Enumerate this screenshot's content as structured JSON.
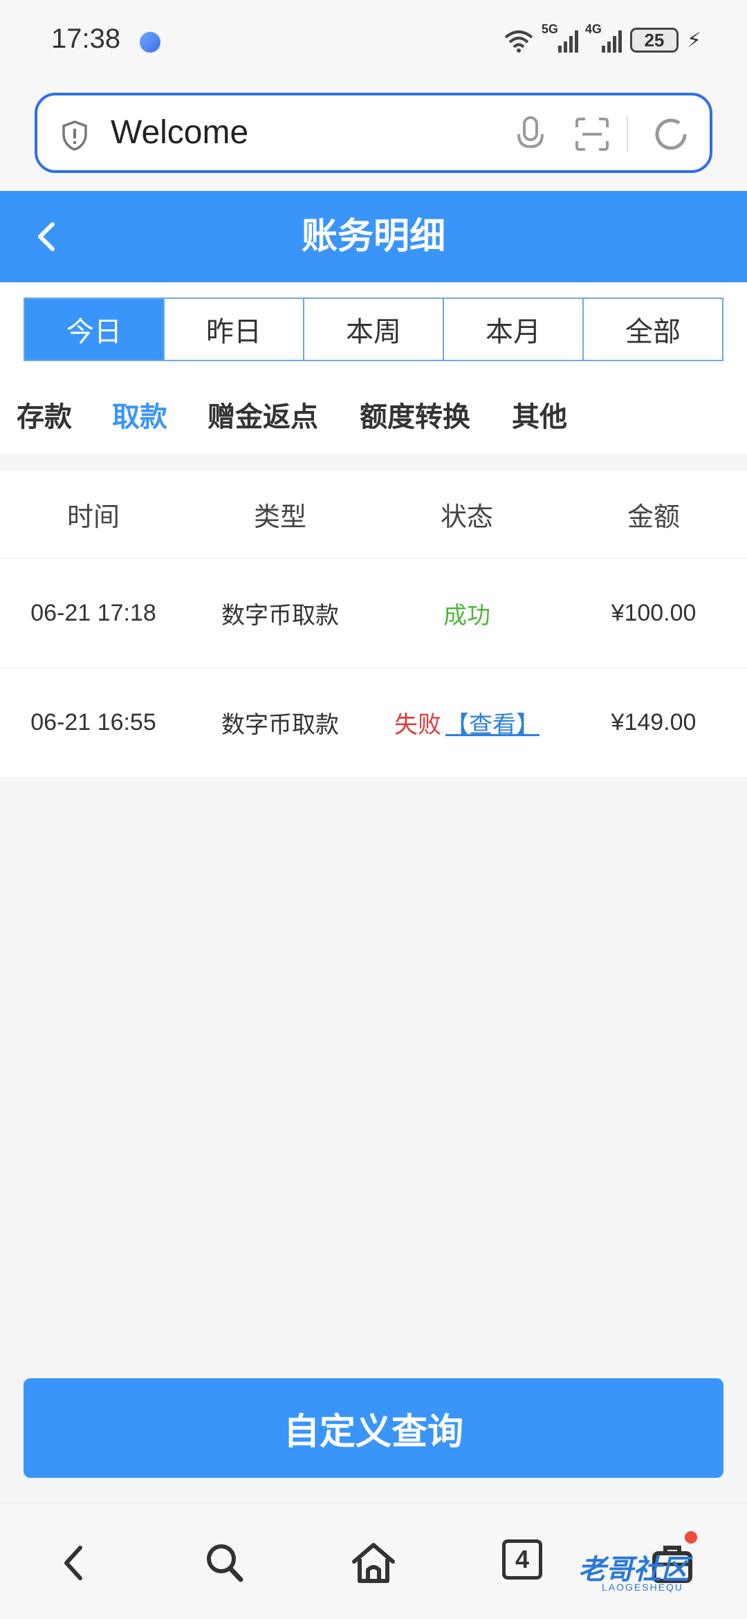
{
  "status_bar": {
    "time": "17:38",
    "network_5g": "5G",
    "network_4g": "4G",
    "battery": "25"
  },
  "browser": {
    "url_text": "Welcome"
  },
  "header": {
    "title": "账务明细"
  },
  "period_tabs": [
    {
      "label": "今日",
      "active": true
    },
    {
      "label": "昨日",
      "active": false
    },
    {
      "label": "本周",
      "active": false
    },
    {
      "label": "本月",
      "active": false
    },
    {
      "label": "全部",
      "active": false
    }
  ],
  "type_tabs": [
    {
      "label": "存款",
      "active": false
    },
    {
      "label": "取款",
      "active": true
    },
    {
      "label": "赠金返点",
      "active": false
    },
    {
      "label": "额度转换",
      "active": false
    },
    {
      "label": "其他",
      "active": false
    }
  ],
  "table": {
    "headers": [
      "时间",
      "类型",
      "状态",
      "金额"
    ],
    "rows": [
      {
        "time": "06-21 17:18",
        "type": "数字币取款",
        "status": "成功",
        "status_kind": "success",
        "view": "",
        "amount": "¥100.00"
      },
      {
        "time": "06-21 16:55",
        "type": "数字币取款",
        "status": "失败",
        "status_kind": "fail",
        "view": "【查看】",
        "amount": "¥149.00"
      }
    ]
  },
  "query_button": {
    "label": "自定义查询"
  },
  "bottom_nav": {
    "tab_count": "4"
  },
  "watermark": {
    "text": "老哥社区",
    "sub": "LAOGESHEQU"
  },
  "colors": {
    "accent": "#3a95fb",
    "success": "#52b540",
    "fail": "#e03a3a",
    "url_border": "#2f6ee8"
  }
}
